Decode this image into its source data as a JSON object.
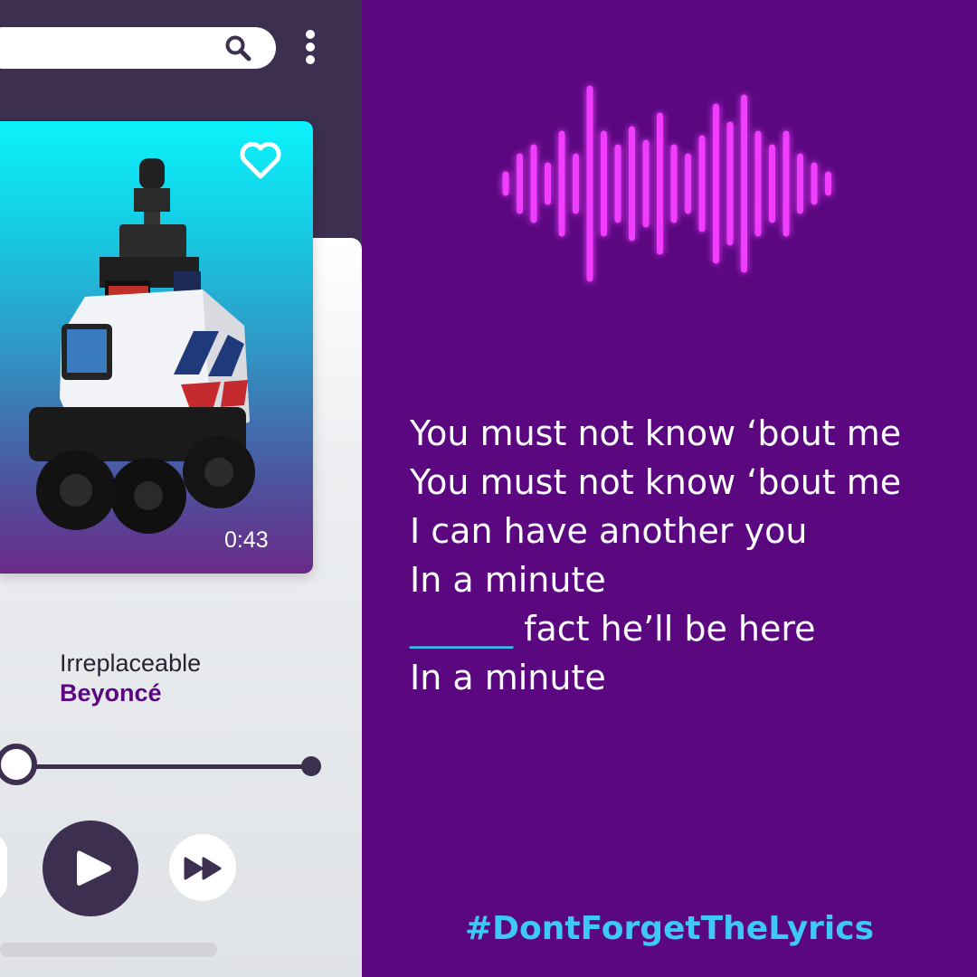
{
  "player": {
    "time": "0:43",
    "song_title": "Irreplaceable",
    "artist": "Beyoncé",
    "progress": 0.0,
    "liked": false,
    "album_art": "security-robot-photo"
  },
  "icons": {
    "search": "search-icon",
    "menu": "more-vertical-icon",
    "heart": "heart-icon",
    "play": "play-icon",
    "forward": "fast-forward-icon",
    "waveform": "audio-waveform-icon"
  },
  "lyrics": {
    "line1": "You must not know ‘bout me",
    "line2": "You must not know ‘bout me",
    "line3": "I can have another you",
    "line4": "In a minute",
    "line5_blank": "______",
    "line5_rest": " fact he’ll be here",
    "line6": "In a minute"
  },
  "hashtag": "#DontForgetTheLyrics",
  "colors": {
    "background": "#5a0780",
    "frame": "#3c2f4f",
    "accent_cyan": "#3ec8f8",
    "neon_pink": "#f03cff"
  }
}
